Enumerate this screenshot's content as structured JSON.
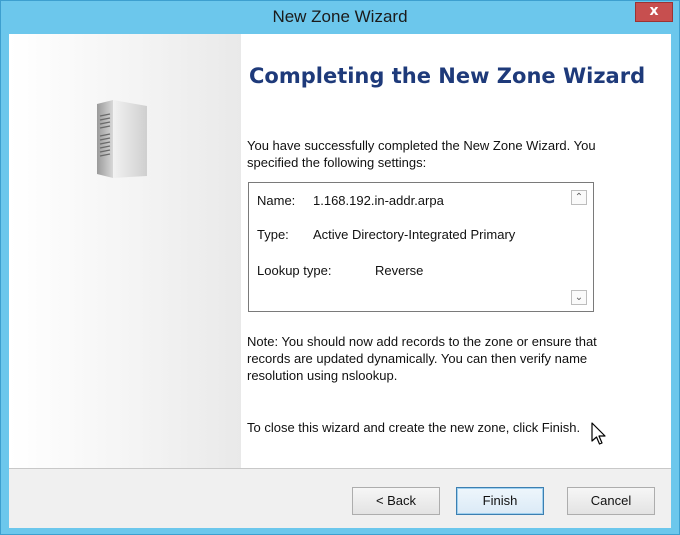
{
  "window": {
    "title": "New Zone Wizard",
    "close_symbol": "x"
  },
  "main": {
    "heading": "Completing the New Zone Wizard",
    "intro": "You have successfully completed the New Zone Wizard. You specified the following settings:",
    "settings": {
      "name_label": "Name:",
      "name_value": "1.168.192.in-addr.arpa",
      "type_label": "Type:",
      "type_value": "Active Directory-Integrated Primary",
      "lookup_label": "Lookup type:",
      "lookup_value": "Reverse"
    },
    "note": "Note: You should now add records to the zone or ensure that records are updated dynamically. You can then verify name resolution using nslookup.",
    "closing": "To close this wizard and create the new zone, click Finish."
  },
  "footer": {
    "back_label": "< Back",
    "finish_label": "Finish",
    "cancel_label": "Cancel"
  },
  "icons": {
    "side_image": "server-tower-icon",
    "close": "close-icon",
    "cursor": "mouse-pointer-icon"
  },
  "colors": {
    "titlebar": "#6cc7ec",
    "close_button": "#c74f4f",
    "heading": "#1e3a7a"
  }
}
